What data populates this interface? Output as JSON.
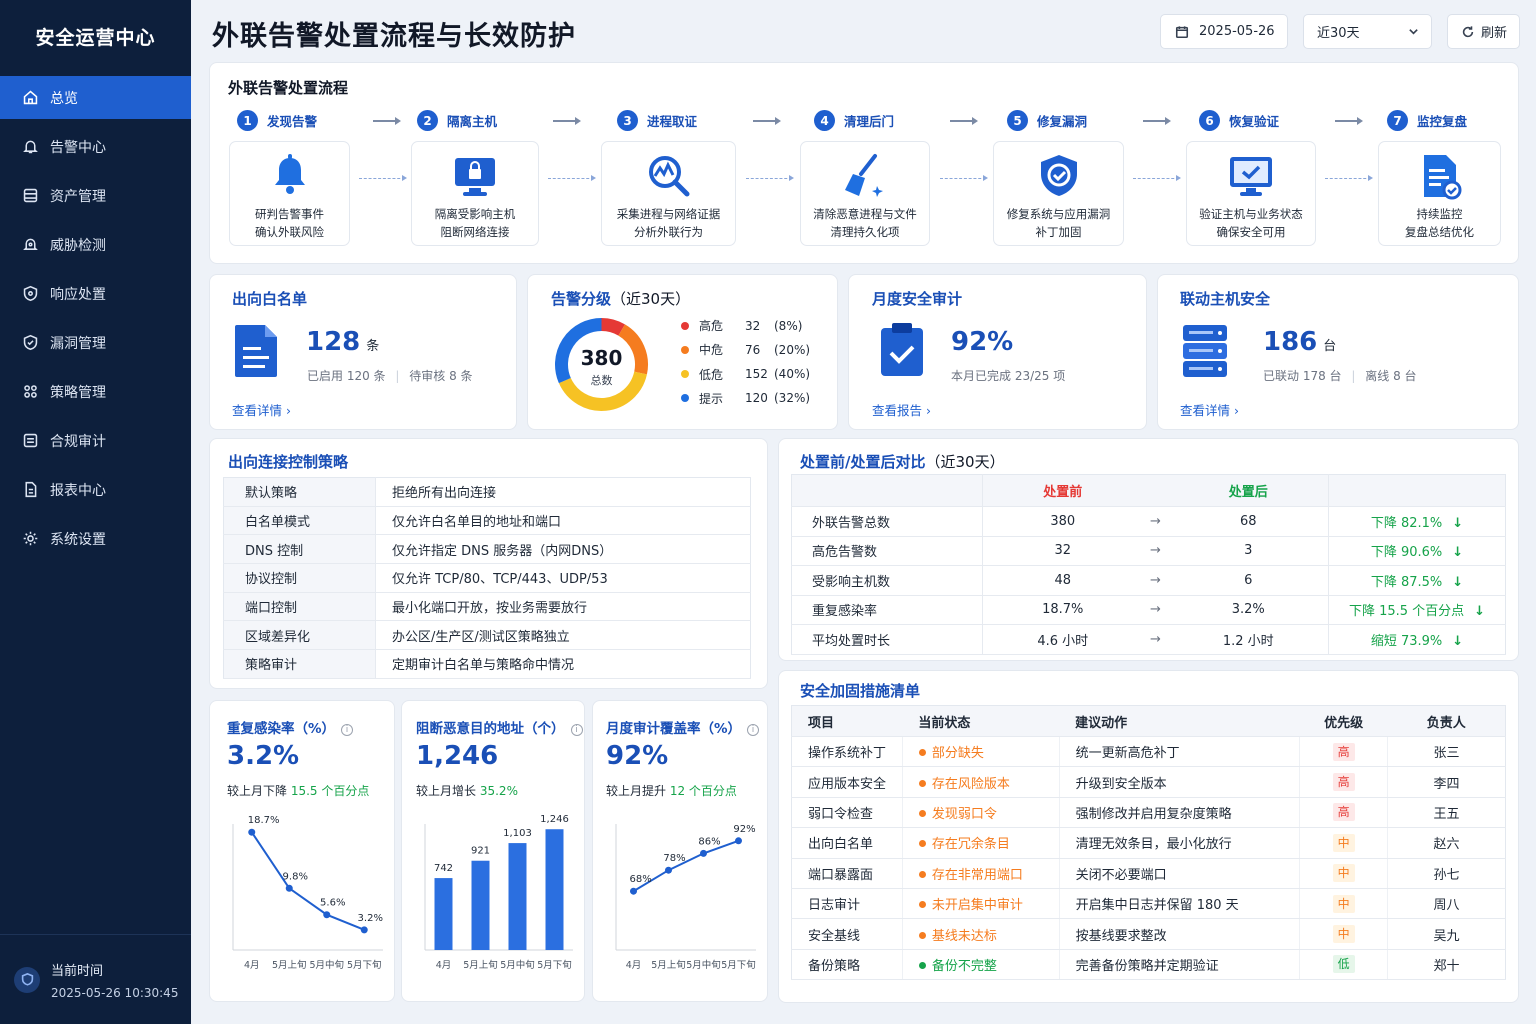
{
  "sidebar": {
    "brand": "安全运营中心",
    "items": [
      {
        "label": "总览",
        "icon": "home-icon"
      },
      {
        "label": "告警中心",
        "icon": "bell-icon"
      },
      {
        "label": "资产管理",
        "icon": "server-icon"
      },
      {
        "label": "威胁检测",
        "icon": "radar-icon"
      },
      {
        "label": "响应处置",
        "icon": "shield-icon"
      },
      {
        "label": "漏洞管理",
        "icon": "shield-check-icon"
      },
      {
        "label": "策略管理",
        "icon": "grid-icon"
      },
      {
        "label": "合规审计",
        "icon": "list-icon"
      },
      {
        "label": "报表中心",
        "icon": "document-icon"
      },
      {
        "label": "系统设置",
        "icon": "gear-icon"
      }
    ],
    "time_label": "当前时间",
    "time_value": "2025-05-26 10:30:45"
  },
  "header": {
    "title": "外联告警处置流程与长效防护",
    "date": "2025-05-26",
    "range": "近30天",
    "refresh": "刷新"
  },
  "flow": {
    "title": "外联告警处置流程",
    "steps": [
      {
        "num": "1",
        "name": "发现告警",
        "line1": "研判告警事件",
        "line2": "确认外联风险"
      },
      {
        "num": "2",
        "name": "隔离主机",
        "line1": "隔离受影响主机",
        "line2": "阻断网络连接"
      },
      {
        "num": "3",
        "name": "进程取证",
        "line1": "采集进程与网络证据",
        "line2": "分析外联行为"
      },
      {
        "num": "4",
        "name": "清理后门",
        "line1": "清除恶意进程与文件",
        "line2": "清理持久化项"
      },
      {
        "num": "5",
        "name": "修复漏洞",
        "line1": "修复系统与应用漏洞",
        "line2": "补丁加固"
      },
      {
        "num": "6",
        "name": "恢复验证",
        "line1": "验证主机与业务状态",
        "line2": "确保安全可用"
      },
      {
        "num": "7",
        "name": "监控复盘",
        "line1": "持续监控",
        "line2": "复盘总结优化"
      }
    ]
  },
  "whitelist": {
    "title": "出向白名单",
    "value": "128",
    "unit": "条",
    "sub1": "已启用 120 条",
    "sub2": "待审核 8 条",
    "link": "查看详情 ›"
  },
  "alerts": {
    "title": "告警分级",
    "title_suffix": "（近30天）",
    "total": "380",
    "total_label": "总数",
    "levels": [
      {
        "name": "高危",
        "count": "32",
        "pct": "(8%)",
        "value": 32,
        "color": "#e53935"
      },
      {
        "name": "中危",
        "count": "76",
        "pct": "(20%)",
        "value": 76,
        "color": "#f57c1f"
      },
      {
        "name": "低危",
        "count": "152",
        "pct": "(40%)",
        "value": 152,
        "color": "#f6c224"
      },
      {
        "name": "提示",
        "count": "120",
        "pct": "(32%)",
        "value": 120,
        "color": "#1f6fe0"
      }
    ]
  },
  "audit": {
    "title": "月度安全审计",
    "value": "92%",
    "sub": "本月已完成  23/25 项",
    "link": "查看报告 ›"
  },
  "hosts": {
    "title": "联动主机安全",
    "value": "186",
    "unit": "台",
    "sub1": "已联动 178 台",
    "sub2": "离线  8 台",
    "link": "查看详情 ›"
  },
  "policy": {
    "title": "出向连接控制策略",
    "rows": [
      [
        "默认策略",
        "拒绝所有出向连接"
      ],
      [
        "白名单模式",
        "仅允许白名单目的地址和端口"
      ],
      [
        "DNS 控制",
        "仅允许指定 DNS 服务器（内网DNS）"
      ],
      [
        "协议控制",
        "仅允许 TCP/80、TCP/443、UDP/53"
      ],
      [
        "端口控制",
        "最小化端口开放，按业务需要放行"
      ],
      [
        "区域差异化",
        "办公区/生产区/测试区策略独立"
      ],
      [
        "策略审计",
        "定期审计白名单与策略命中情况"
      ]
    ]
  },
  "compare": {
    "title": "处置前/处置后对比",
    "title_suffix": "（近30天）",
    "before": "处置前",
    "after": "处置后",
    "arrow": "→",
    "rows": [
      [
        "外联告警总数",
        "380",
        "68",
        "下降 82.1%"
      ],
      [
        "高危告警数",
        "32",
        "3",
        "下降 90.6%"
      ],
      [
        "受影响主机数",
        "48",
        "6",
        "下降 87.5%"
      ],
      [
        "重复感染率",
        "18.7%",
        "3.2%",
        "下降 15.5 个百分点"
      ],
      [
        "平均处置时长",
        "4.6 小时",
        "1.2 小时",
        "缩短 73.9%"
      ]
    ]
  },
  "harden": {
    "title": "安全加固措施清单",
    "headers": [
      "项目",
      "当前状态",
      "建议动作",
      "优先级",
      "负责人"
    ],
    "rows": [
      [
        "操作系统补丁",
        "部分缺失",
        "统一更新高危补丁",
        "高",
        "张三"
      ],
      [
        "应用版本安全",
        "存在风险版本",
        "升级到安全版本",
        "高",
        "李四"
      ],
      [
        "弱口令检查",
        "发现弱口令",
        "强制修改并启用复杂度策略",
        "高",
        "王五"
      ],
      [
        "出向白名单",
        "存在冗余条目",
        "清理无效条目，最小化放行",
        "中",
        "赵六"
      ],
      [
        "端口暴露面",
        "存在非常用端口",
        "关闭不必要端口",
        "中",
        "孙七"
      ],
      [
        "日志审计",
        "未开启集中审计",
        "开启集中日志并保留 180 天",
        "中",
        "周八"
      ],
      [
        "安全基线",
        "基线未达标",
        "按基线要求整改",
        "中",
        "吴九"
      ],
      [
        "备份策略",
        "备份不完整",
        "完善备份策略并定期验证",
        "低",
        "郑十"
      ]
    ]
  },
  "stat1": {
    "title": "重复感染率（%）",
    "value": "3.2%",
    "sub": "较上月下降",
    "delta": "15.5 个百分点"
  },
  "stat2": {
    "title": "阻断恶意目的地址（个）",
    "value": "1,246",
    "sub": "较上月增长",
    "delta": "35.2%"
  },
  "stat3": {
    "title": "月度审计覆盖率（%）",
    "value": "92%",
    "sub": "较上月提升",
    "delta": "12 个百分点"
  },
  "chart_data": [
    {
      "type": "line",
      "categories": [
        "4月",
        "5月上旬",
        "5月中旬",
        "5月下旬"
      ],
      "values": [
        18.7,
        9.8,
        5.6,
        3.2
      ],
      "labels": [
        "18.7%",
        "9.8%",
        "5.6%",
        "3.2%"
      ],
      "ylim": [
        0,
        20
      ]
    },
    {
      "type": "bar",
      "categories": [
        "4月",
        "5月上旬",
        "5月中旬",
        "5月下旬"
      ],
      "values": [
        742,
        921,
        1103,
        1246
      ],
      "labels": [
        "742",
        "921",
        "1,103",
        "1,246"
      ],
      "ylim": [
        0,
        1300
      ]
    },
    {
      "type": "line",
      "categories": [
        "4月",
        "5月上旬",
        "5月中旬",
        "5月下旬"
      ],
      "values": [
        68,
        78,
        86,
        92
      ],
      "labels": [
        "68%",
        "78%",
        "86%",
        "92%"
      ],
      "ylim": [
        40,
        100
      ]
    }
  ],
  "colors": {
    "accent": "#1f5fcf",
    "green": "#16a34a",
    "red": "#e53935",
    "orange": "#f57c1f"
  }
}
